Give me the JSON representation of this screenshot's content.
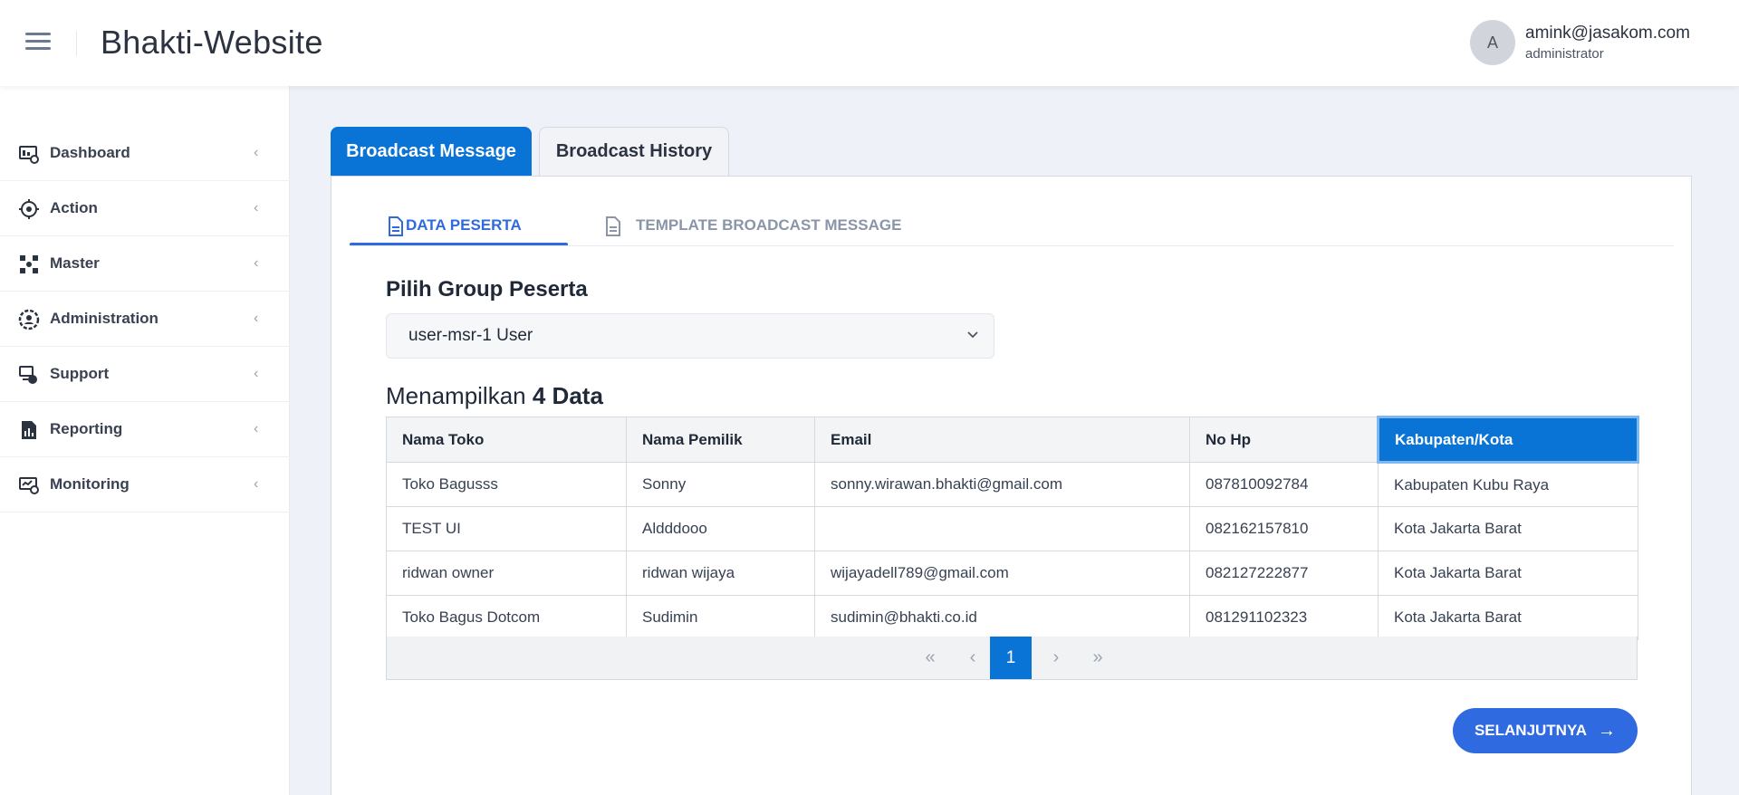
{
  "header": {
    "title": "Bhakti-Website",
    "user": {
      "initial": "A",
      "email": "amink@jasakom.com",
      "role": "administrator"
    }
  },
  "sidebar": {
    "items": [
      {
        "label": "Dashboard",
        "icon": "dashboard-icon"
      },
      {
        "label": "Action",
        "icon": "action-icon"
      },
      {
        "label": "Master",
        "icon": "master-icon"
      },
      {
        "label": "Administration",
        "icon": "administration-icon"
      },
      {
        "label": "Support",
        "icon": "support-icon"
      },
      {
        "label": "Reporting",
        "icon": "reporting-icon"
      },
      {
        "label": "Monitoring",
        "icon": "monitoring-icon"
      }
    ],
    "chevron": "‹"
  },
  "main_tabs": [
    {
      "label": "Broadcast Message",
      "active": true
    },
    {
      "label": "Broadcast History",
      "active": false
    }
  ],
  "sub_tabs": [
    {
      "label": "DATA PESERTA",
      "active": true
    },
    {
      "label": "TEMPLATE BROADCAST MESSAGE",
      "active": false
    }
  ],
  "form": {
    "group_label": "Pilih Group Peserta",
    "group_value": "user-msr-1 User"
  },
  "summary": {
    "prefix": "Menampilkan",
    "count": "4 Data"
  },
  "table": {
    "columns": [
      "Nama Toko",
      "Nama Pemilik",
      "Email",
      "No Hp",
      "Kabupaten/Kota"
    ],
    "rows": [
      [
        "Toko Bagusss",
        "Sonny",
        "sonny.wirawan.bhakti@gmail.com",
        "087810092784",
        "Kabupaten Kubu Raya"
      ],
      [
        "TEST UI",
        "Aldddooo",
        "",
        "082162157810",
        "Kota Jakarta Barat"
      ],
      [
        "ridwan owner",
        "ridwan wijaya",
        "wijayadell789@gmail.com",
        "082127222877",
        "Kota Jakarta Barat"
      ],
      [
        "Toko Bagus Dotcom",
        "Sudimin",
        "sudimin@bhakti.co.id",
        "081291102323",
        "Kota Jakarta Barat"
      ]
    ]
  },
  "pagination": {
    "first": "«",
    "prev": "‹",
    "current": "1",
    "next": "›",
    "last": "»"
  },
  "actions": {
    "next_label": "SELANJUTNYA",
    "next_arrow": "→"
  },
  "colors": {
    "primary": "#0a74d6",
    "accent": "#2f6ae0"
  }
}
